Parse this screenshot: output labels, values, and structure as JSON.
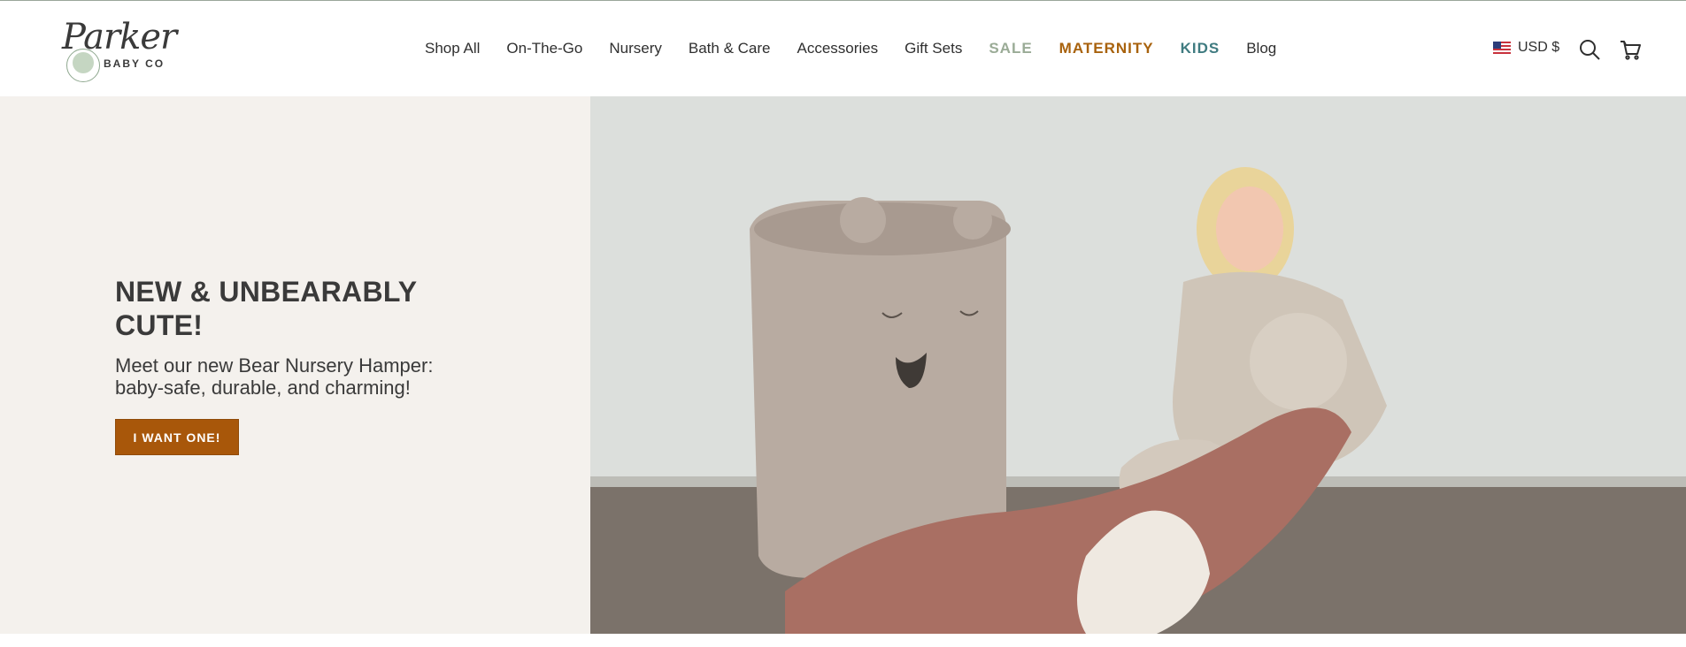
{
  "header": {
    "logo": {
      "script": "Parker",
      "sub": "BABY CO"
    },
    "nav": [
      {
        "label": "Shop All",
        "style": "normal"
      },
      {
        "label": "On-The-Go",
        "style": "normal"
      },
      {
        "label": "Nursery",
        "style": "normal"
      },
      {
        "label": "Bath & Care",
        "style": "normal"
      },
      {
        "label": "Accessories",
        "style": "normal"
      },
      {
        "label": "Gift Sets",
        "style": "normal"
      },
      {
        "label": "SALE",
        "style": "sale"
      },
      {
        "label": "MATERNITY",
        "style": "maternity"
      },
      {
        "label": "KIDS",
        "style": "kids"
      },
      {
        "label": "Blog",
        "style": "normal"
      }
    ],
    "currency": "USD $",
    "icons": {
      "search": "search-icon",
      "cart": "cart-icon",
      "flag": "us-flag-icon"
    }
  },
  "hero": {
    "title": "NEW & UNBEARABLY CUTE!",
    "text": "Meet our new Bear Nursery Hamper: baby-safe, durable, and charming!",
    "button": "I WANT ONE!"
  },
  "colors": {
    "accent": "#a8570a",
    "sale": "#9aab96",
    "maternity": "#a8620d",
    "kids": "#3f7b80",
    "hero_bg": "#f4f1ed"
  }
}
